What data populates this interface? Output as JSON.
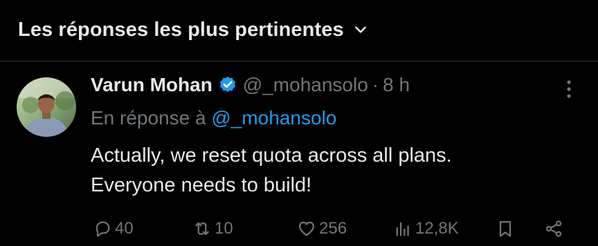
{
  "sort": {
    "label": "Les réponses les plus pertinentes",
    "icon": "chevron-down-icon"
  },
  "tweet": {
    "author_name": "Varun Mohan",
    "verified": true,
    "handle": "@_mohansolo",
    "separator": "·",
    "time": "8 h",
    "reply_prefix": "En réponse à",
    "reply_handle": "@_mohansolo",
    "text_line1": "Actually, we reset quota across all plans.",
    "text_line2": "Everyone needs to build!",
    "actions": {
      "replies": "40",
      "reposts": "10",
      "likes": "256",
      "views": "12,8K"
    }
  },
  "colors": {
    "background": "#000000",
    "text": "#e7e9ea",
    "secondary": "#71767b",
    "accent": "#1d9bf0",
    "divider": "#2f3336"
  }
}
